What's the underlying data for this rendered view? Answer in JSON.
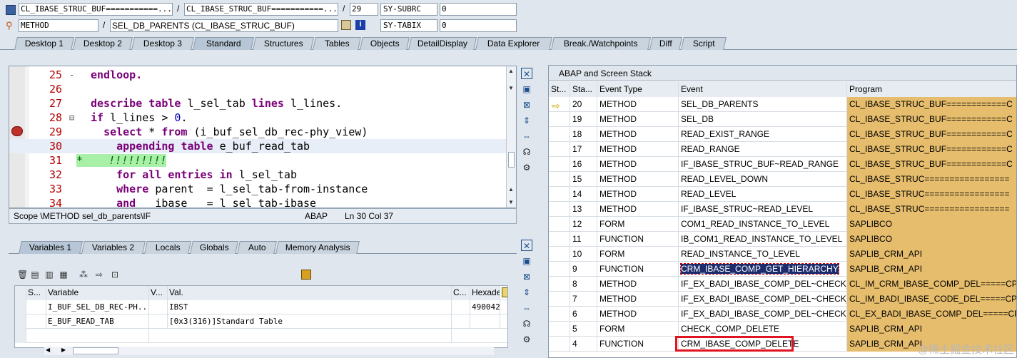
{
  "header": {
    "class_field_1": "CL_IBASE_STRUC_BUF===========...",
    "class_field_2": "CL_IBASE_STRUC_BUF===========...",
    "line_number": "29",
    "sy_subrc_label": "SY-SUBRC",
    "sy_subrc_value": "0",
    "type_value": "METHOD",
    "method_value": "SEL_DB_PARENTS (CL_IBASE_STRUC_BUF)",
    "sy_tabix_label": "SY-TABIX",
    "sy_tabix_value": "0",
    "slash": "/"
  },
  "tabs": [
    "Desktop 1",
    "Desktop 2",
    "Desktop 3",
    "Standard",
    "Structures",
    "Tables",
    "Objects",
    "DetailDisplay",
    "Data Explorer",
    "Break./Watchpoints",
    "Diff",
    "Script"
  ],
  "code": {
    "lines": [
      {
        "num": "25",
        "mark": "-",
        "text": "endloop."
      },
      {
        "num": "26",
        "mark": "",
        "text": ""
      },
      {
        "num": "27",
        "mark": "",
        "text": "describe table l_sel_tab lines l_lines."
      },
      {
        "num": "28",
        "mark": "⊟",
        "text": "if l_lines > 0."
      },
      {
        "num": "29",
        "mark": "",
        "text": "  select * from (i_buf_sel_db_rec-phy_view)"
      },
      {
        "num": "30",
        "mark": "",
        "text": "    appending table e_buf_read_tab"
      },
      {
        "num": "31",
        "mark": "",
        "text": "*    !!!!!!!!!"
      },
      {
        "num": "32",
        "mark": "",
        "text": "    for all entries in l_sel_tab"
      },
      {
        "num": "33",
        "mark": "",
        "text": "    where parent  = l_sel_tab-from-instance"
      },
      {
        "num": "34",
        "mark": "",
        "text": "    and   ibase   = l_sel_tab-ibase"
      }
    ],
    "status_scope": "Scope \\METHOD sel_db_parents\\IF",
    "status_lang": "ABAP",
    "status_pos": "Ln  30 Col  37"
  },
  "var_tabs": [
    "Variables 1",
    "Variables 2",
    "Locals",
    "Globals",
    "Auto",
    "Memory Analysis"
  ],
  "var_table": {
    "headers": [
      "S...",
      "Variable",
      "V...",
      "Val.",
      "C...",
      "Hexade"
    ],
    "rows": [
      {
        "variable": "I_BUF_SEL_DB_REC-PH...",
        "value": "IBST",
        "hex": "490042"
      },
      {
        "variable": "E_BUF_READ_TAB",
        "value": "[0x3(316)]Standard Table",
        "hex": ""
      }
    ]
  },
  "stack": {
    "title": "ABAP and Screen Stack",
    "headers": [
      "St...",
      "Sta...",
      "Event Type",
      "Event",
      "Program"
    ],
    "rows": [
      {
        "level": "20",
        "type": "METHOD",
        "event": "SEL_DB_PARENTS",
        "program": "CL_IBASE_STRUC_BUF============C"
      },
      {
        "level": "19",
        "type": "METHOD",
        "event": "SEL_DB",
        "program": "CL_IBASE_STRUC_BUF============C"
      },
      {
        "level": "18",
        "type": "METHOD",
        "event": "READ_EXIST_RANGE",
        "program": "CL_IBASE_STRUC_BUF============C"
      },
      {
        "level": "17",
        "type": "METHOD",
        "event": "READ_RANGE",
        "program": "CL_IBASE_STRUC_BUF============C"
      },
      {
        "level": "16",
        "type": "METHOD",
        "event": "IF_IBASE_STRUC_BUF~READ_RANGE",
        "program": "CL_IBASE_STRUC_BUF============C"
      },
      {
        "level": "15",
        "type": "METHOD",
        "event": "READ_LEVEL_DOWN",
        "program": "CL_IBASE_STRUC================="
      },
      {
        "level": "14",
        "type": "METHOD",
        "event": "READ_LEVEL",
        "program": "CL_IBASE_STRUC================="
      },
      {
        "level": "13",
        "type": "METHOD",
        "event": "IF_IBASE_STRUC~READ_LEVEL",
        "program": "CL_IBASE_STRUC================="
      },
      {
        "level": "12",
        "type": "FORM",
        "event": "COM1_READ_INSTANCE_TO_LEVEL",
        "program": "SAPLIBCO"
      },
      {
        "level": "11",
        "type": "FUNCTION",
        "event": "IB_COM1_READ_INSTANCE_TO_LEVEL",
        "program": "SAPLIBCO"
      },
      {
        "level": "10",
        "type": "FORM",
        "event": "READ_INSTANCE_TO_LEVEL",
        "program": "SAPLIB_CRM_API"
      },
      {
        "level": "9",
        "type": "FUNCTION",
        "event": "CRM_IBASE_COMP_GET_HIERARCHY",
        "program": "SAPLIB_CRM_API"
      },
      {
        "level": "8",
        "type": "METHOD",
        "event": "IF_EX_BADI_IBASE_COMP_DEL~CHECK_...",
        "program": "CL_IM_CRM_IBASE_COMP_DEL=====CP"
      },
      {
        "level": "7",
        "type": "METHOD",
        "event": "IF_EX_BADI_IBASE_COMP_DEL~CHECK_...",
        "program": "CL_IM_BADI_IBASE_CODE_DEL=====CP"
      },
      {
        "level": "6",
        "type": "METHOD",
        "event": "IF_EX_BADI_IBASE_COMP_DEL~CHECK_...",
        "program": "CL_EX_BADI_IBASE_COMP_DEL=====CP"
      },
      {
        "level": "5",
        "type": "FORM",
        "event": "CHECK_COMP_DELETE",
        "program": "SAPLIB_CRM_API"
      },
      {
        "level": "4",
        "type": "FUNCTION",
        "event": "CRM_IBASE_COMP_DELETE",
        "program": "SAPLIB_CRM_API"
      }
    ]
  },
  "watermark": "@稀土掘金技术社区",
  "colors": {
    "program_cell": "#e6bd6c",
    "selection": "#1c2c6c",
    "highlight_box": "#e0141e",
    "comment_bg": "#a8f0a8"
  }
}
